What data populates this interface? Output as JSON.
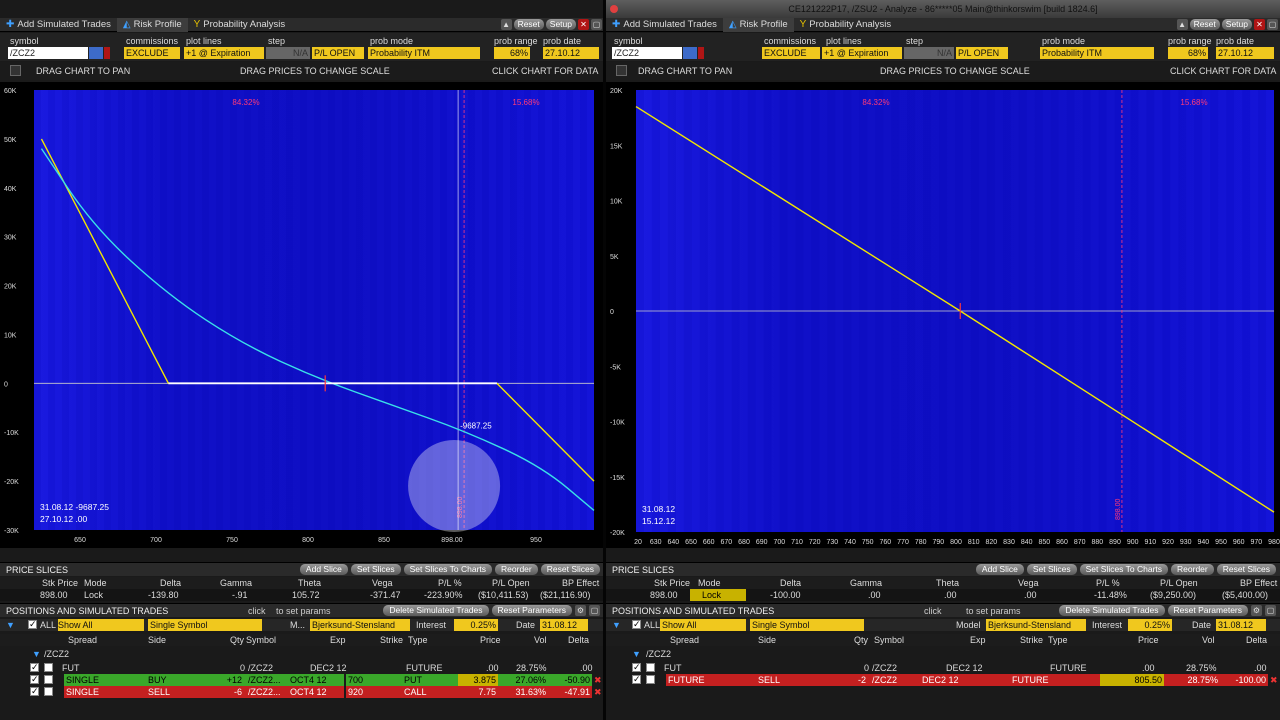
{
  "left": {
    "tabs": [
      {
        "label": "Add Simulated Trades",
        "icon": "plus-icon"
      },
      {
        "label": "Risk Profile",
        "icon": "risk-profile-icon",
        "active": true
      },
      {
        "label": "Probability Analysis",
        "icon": "probability-icon"
      }
    ],
    "buttons": {
      "reset": "Reset",
      "setup": "Setup"
    },
    "controls": {
      "symbol_label": "symbol",
      "symbol": "/ZCZ2",
      "commissions_label": "commissions",
      "commissions": "EXCLUDE",
      "plot_lines_label": "plot lines",
      "plot_lines": "+1 @ Expiration",
      "step_label": "step",
      "step": "N/A",
      "pl_open": "P/L OPEN",
      "prob_mode_label": "prob mode",
      "prob_mode": "Probability ITM",
      "prob_range_label": "prob range",
      "prob_range": "68%",
      "prob_date_label": "prob date",
      "prob_date": "27.10.12"
    },
    "hints": {
      "pan": "DRAG CHART TO PAN",
      "scale": "DRAG PRICES TO CHANGE SCALE",
      "data": "CLICK CHART FOR DATA"
    },
    "chart": {
      "pct_left": "84.32%",
      "pct_right": "15.68%",
      "y_ticks": [
        "60K",
        "50K",
        "40K",
        "30K",
        "20K",
        "10K",
        "0",
        "-10K",
        "-20K",
        "-30K"
      ],
      "x_ticks": [
        "650",
        "700",
        "750",
        "800",
        "850",
        "898.00",
        "950"
      ],
      "cursor_label": "-9687.25",
      "readout_1": "31.08.12  -9687.25",
      "readout_2": "27.10.12  .00",
      "marker_label": "898.00"
    },
    "chart_data": {
      "type": "line",
      "x_range": [
        610,
        985
      ],
      "y_range": [
        -30000,
        60000
      ],
      "series": [
        {
          "points": [
            [
              615,
              50000
            ],
            [
              700,
              0
            ],
            [
              920,
              0
            ],
            [
              985,
              -20000
            ]
          ]
        },
        {
          "points": [
            [
              615,
              48000
            ],
            [
              650,
              32000
            ],
            [
              700,
              18000
            ],
            [
              750,
              8000
            ],
            [
              800,
              1000
            ],
            [
              850,
              -4500
            ],
            [
              898,
              -9687.25
            ],
            [
              950,
              -17000
            ],
            [
              985,
              -26000
            ]
          ]
        }
      ],
      "vertical_markers": [
        898
      ]
    },
    "price_slices": {
      "title": "PRICE SLICES",
      "buttons": [
        "Add Slice",
        "Set Slices",
        "Set Slices To Charts",
        "Reorder",
        "Reset Slices"
      ],
      "headers": [
        "Stk Price",
        "Mode",
        "Delta",
        "Gamma",
        "Theta",
        "Vega",
        "P/L %",
        "P/L Open",
        "BP Effect"
      ],
      "values": [
        "898.00",
        "Lock",
        "-139.80",
        "-.91",
        "105.72",
        "-371.47",
        "-223.90%",
        "($10,411.53)",
        "($21,116.90)"
      ]
    },
    "positions": {
      "title": "POSITIONS AND SIMULATED TRADES",
      "click_hint": "click",
      "click_hint2": "to set params",
      "buttons": [
        "Delete Simulated Trades",
        "Reset Parameters"
      ],
      "all": "ALL",
      "show_all": "Show All",
      "single_symbol": "Single Symbol",
      "model_label": "M...",
      "model": "Bjerksund-Stensland",
      "interest_label": "Interest",
      "interest": "0.25%",
      "date_label": "Date",
      "date": "31.08.12",
      "columns": [
        "Spread",
        "Side",
        "Qty",
        "Symbol",
        "Exp",
        "Strike",
        "Type",
        "Price",
        "Vol",
        "Delta"
      ],
      "group": "/ZCZ2",
      "rows": [
        {
          "spread": "FUT",
          "side": "",
          "qty": "0",
          "symbol": "/ZCZ2",
          "exp": "DEC2 12",
          "strike": "",
          "type": "FUTURE",
          "price": ".00",
          "vol": "28.75%",
          "delta": ".00"
        },
        {
          "spread": "SINGLE",
          "side": "BUY",
          "qty": "+12",
          "symbol": "/ZCZ2...",
          "exp": "OCT4 12",
          "strike": "700",
          "type": "PUT",
          "price": "3.875",
          "vol": "27.06%",
          "delta": "-50.90"
        },
        {
          "spread": "SINGLE",
          "side": "SELL",
          "qty": "-6",
          "symbol": "/ZCZ2...",
          "exp": "OCT4 12",
          "strike": "920",
          "type": "CALL",
          "price": "7.75",
          "vol": "31.63%",
          "delta": "-47.91"
        }
      ]
    }
  },
  "right": {
    "window_title": "CE121222P17, /ZSU2 - Analyze - 86*****05 Main@thinkorswim [build 1824.6]",
    "tabs": [
      {
        "label": "Add Simulated Trades",
        "icon": "plus-icon"
      },
      {
        "label": "Risk Profile",
        "icon": "risk-profile-icon",
        "active": true
      },
      {
        "label": "Probability Analysis",
        "icon": "probability-icon"
      }
    ],
    "buttons": {
      "reset": "Reset",
      "setup": "Setup"
    },
    "controls": {
      "symbol_label": "symbol",
      "symbol": "/ZCZ2",
      "commissions_label": "commissions",
      "commissions": "EXCLUDE",
      "plot_lines_label": "plot lines",
      "plot_lines": "+1 @ Expiration",
      "step_label": "step",
      "step": "N/A",
      "pl_open": "P/L OPEN",
      "prob_mode_label": "prob mode",
      "prob_mode": "Probability ITM",
      "prob_range_label": "prob range",
      "prob_range": "68%",
      "prob_date_label": "prob date",
      "prob_date": "27.10.12"
    },
    "hints": {
      "pan": "DRAG CHART TO PAN",
      "scale": "DRAG PRICES TO CHANGE SCALE",
      "data": "CLICK CHART FOR DATA"
    },
    "chart": {
      "pct_left": "84.32%",
      "pct_right": "15.68%",
      "y_ticks": [
        "20K",
        "15K",
        "10K",
        "5K",
        "0",
        "-5K",
        "-10K",
        "-15K",
        "-20K"
      ],
      "x_ticks": [
        "20",
        "630",
        "640",
        "650",
        "660",
        "670",
        "680",
        "690",
        "700",
        "710",
        "720",
        "730",
        "740",
        "750",
        "760",
        "770",
        "780",
        "790",
        "800",
        "810",
        "820",
        "830",
        "840",
        "850",
        "860",
        "870",
        "880",
        "890",
        "900",
        "910",
        "920",
        "930",
        "940",
        "950",
        "960",
        "970",
        "980"
      ],
      "readout_1": "31.08.12",
      "readout_2": "15.12.12",
      "marker_label": "898.00"
    },
    "chart_data": {
      "type": "line",
      "x_range": [
        620,
        985
      ],
      "y_range": [
        -20000,
        20000
      ],
      "series": [
        {
          "points": [
            [
              620,
              18500
            ],
            [
              805.5,
              0
            ],
            [
              985,
              -18200
            ]
          ]
        }
      ],
      "vertical_markers": [
        898
      ]
    },
    "price_slices": {
      "title": "PRICE SLICES",
      "buttons": [
        "Add Slice",
        "Set Slices",
        "Set Slices To Charts",
        "Reorder",
        "Reset Slices"
      ],
      "headers": [
        "Stk Price",
        "Mode",
        "Delta",
        "Gamma",
        "Theta",
        "Vega",
        "P/L %",
        "P/L Open",
        "BP Effect"
      ],
      "values": [
        "898.00",
        "Lock",
        "-100.00",
        ".00",
        ".00",
        ".00",
        "-11.48%",
        "($9,250.00)",
        "($5,400.00)"
      ]
    },
    "positions": {
      "title": "POSITIONS AND SIMULATED TRADES",
      "click_hint": "click",
      "click_hint2": "to set params",
      "buttons": [
        "Delete Simulated Trades",
        "Reset Parameters"
      ],
      "all": "ALL",
      "show_all": "Show All",
      "single_symbol": "Single Symbol",
      "model_label": "Model",
      "model": "Bjerksund-Stensland",
      "interest_label": "Interest",
      "interest": "0.25%",
      "date_label": "Date",
      "date": "31.08.12",
      "columns": [
        "Spread",
        "Side",
        "Qty",
        "Symbol",
        "Exp",
        "Strike",
        "Type",
        "Price",
        "Vol",
        "Delta"
      ],
      "group": "/ZCZ2",
      "rows": [
        {
          "spread": "FUT",
          "side": "",
          "qty": "0",
          "symbol": "/ZCZ2",
          "exp": "DEC2 12",
          "strike": "",
          "type": "FUTURE",
          "price": ".00",
          "vol": "28.75%",
          "delta": ".00"
        },
        {
          "spread": "FUTURE",
          "side": "SELL",
          "qty": "-2",
          "symbol": "/ZCZ2",
          "exp": "DEC2 12",
          "strike": "",
          "type": "FUTURE",
          "price": "805.50",
          "vol": "28.75%",
          "delta": "-100.00"
        }
      ]
    }
  }
}
